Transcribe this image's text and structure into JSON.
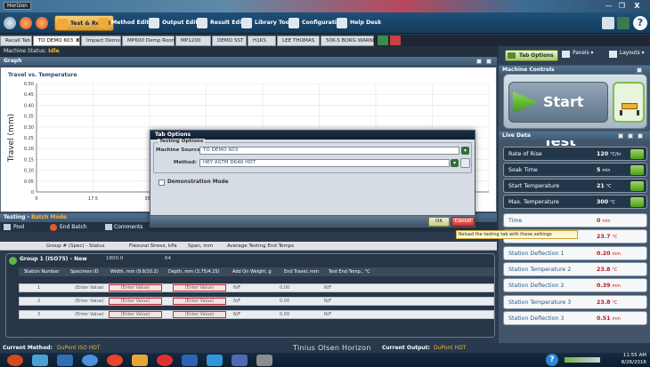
{
  "window": {
    "title": "Horizon",
    "minimize": "—",
    "maximize": "❐",
    "close": "X"
  },
  "ribbon": {
    "items": [
      {
        "label": "Test & Recall",
        "active": true
      },
      {
        "label": "Method Editor"
      },
      {
        "label": "Output Editor"
      },
      {
        "label": "Result Editor"
      },
      {
        "label": "Library Tools"
      },
      {
        "label": "Configuration"
      },
      {
        "label": "Help Desk"
      }
    ]
  },
  "tabs": [
    "Recall Tab",
    "TO DEMO 603",
    "Impact Demo",
    "MP600 Demp Room",
    "MP1200",
    "DEMO SST",
    "H1KS",
    "LEE THOMAS",
    "50K-S BORG WARNER"
  ],
  "tab_close": "X",
  "status": {
    "label": "Machine Status:",
    "value": "Idle"
  },
  "graph": {
    "header": "Graph"
  },
  "chart_data": {
    "type": "line",
    "title": "Travel vs. Temperature",
    "ylabel": "Travel (mm)",
    "xlabel": "",
    "y_ticks": [
      "0.50",
      "0.45",
      "0.40",
      "0.35",
      "0.30",
      "0.25",
      "0.20",
      "0.15",
      "0.10",
      "0.05",
      "0"
    ],
    "x_ticks": [
      "0",
      "17.5",
      "35.0"
    ],
    "ylim": [
      0,
      0.5
    ],
    "series": []
  },
  "testing": {
    "header": "Testing -",
    "subheader": "Batch Mode"
  },
  "toolstrip": {
    "pool": "Pool",
    "end_batch": "End Batch",
    "comments": "Comments"
  },
  "columns": {
    "group_status": "Group # (Spec) - Status",
    "flexural": "Flexural Stress, kPa",
    "span": "Span, mm",
    "avg_end": "Average Testing End Temps"
  },
  "group": {
    "title": "Group 1 (ISO75) -",
    "status": "New",
    "flexural": "1800.0",
    "span": "64",
    "headers": [
      "Station Number",
      "Specimen ID",
      "Width, mm (9.8/10.2)",
      "Depth, mm (3.75/4.25)",
      "Add On Weight, g",
      "End Travel, mm",
      "Test End Temp., °C"
    ],
    "rows": [
      {
        "num": "1",
        "spec": "(Enter Value)",
        "width": "(Enter Value)",
        "depth": "(Enter Value)",
        "addon": "N/F",
        "travel": "0.00",
        "temp": "N/F"
      },
      {
        "num": "2",
        "spec": "(Enter Value)",
        "width": "(Enter Value)",
        "depth": "(Enter Value)",
        "addon": "N/F",
        "travel": "0.00",
        "temp": "N/F"
      },
      {
        "num": "3",
        "spec": "(Enter Value)",
        "width": "(Enter Value)",
        "depth": "(Enter Value)",
        "addon": "N/F",
        "travel": "0.00",
        "temp": "N/F"
      }
    ]
  },
  "side": {
    "tab_options": "Tab Options",
    "panels": "Panels",
    "layouts": "Layouts",
    "machine_controls": "Machine Controls",
    "start_test": "Start Test",
    "live_data": "Live Data"
  },
  "live_data": [
    {
      "label": "Rate of Rise",
      "value": "120",
      "unit": "°C/hr",
      "style": "dark",
      "button": true
    },
    {
      "label": "Soak Time",
      "value": "5",
      "unit": "min",
      "style": "dark",
      "button": true
    },
    {
      "label": "Start Temperature",
      "value": "21",
      "unit": "°C",
      "style": "dark",
      "button": true
    },
    {
      "label": "Max. Temperature",
      "value": "300",
      "unit": "°C",
      "style": "dark",
      "button": true
    },
    {
      "label": "Time",
      "value": "0",
      "unit": "min",
      "style": "light",
      "button": false
    },
    {
      "label": "Station Temperature 1",
      "value": "23.7",
      "unit": "°C",
      "style": "light",
      "button": false
    },
    {
      "label": "Station Deflection 1",
      "value": "0.20",
      "unit": "mm",
      "style": "light",
      "button": false
    },
    {
      "label": "Station Temperature 2",
      "value": "23.8",
      "unit": "°C",
      "style": "light",
      "button": false
    },
    {
      "label": "Station Deflection 2",
      "value": "0.39",
      "unit": "mm",
      "style": "light",
      "button": false
    },
    {
      "label": "Station Temperature 3",
      "value": "23.8",
      "unit": "°C",
      "style": "light",
      "button": false
    },
    {
      "label": "Station Deflection 3",
      "value": "0.51",
      "unit": "mm",
      "style": "light",
      "button": false
    }
  ],
  "modal": {
    "title": "Tab Options",
    "legend": "Testing Options",
    "machine_source_label": "Machine Source:",
    "machine_source_value": "TO DEMO 603",
    "method_label": "Method:",
    "method_value": "HEY ASTM D648 HDT",
    "demo_label": "Demonstration Mode",
    "ok": "OK",
    "cancel": "Cancel",
    "tooltip": "Reload the testing tab with these settings"
  },
  "footer": {
    "method_label": "Current Method:",
    "method_value": "DuPont ISO HDT",
    "brand": "Tinius Olsen Horizon",
    "output_label": "Current Output:",
    "output_value": "DuPont HDT"
  },
  "taskbar": {
    "time": "11:55 AM",
    "date": "8/26/2016"
  }
}
